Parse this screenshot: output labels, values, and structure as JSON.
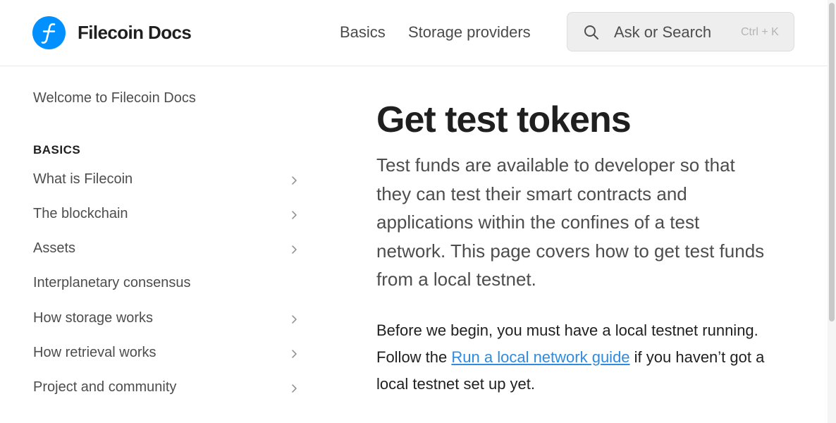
{
  "brand": {
    "name": "Filecoin Docs",
    "logo_icon": "filecoin-logo-icon",
    "logo_color": "#0090ff"
  },
  "topnav": {
    "items": [
      {
        "label": "Basics"
      },
      {
        "label": "Storage providers"
      }
    ]
  },
  "search": {
    "placeholder": "Ask or Search",
    "shortcut": "Ctrl + K",
    "icon": "search-icon"
  },
  "sidebar": {
    "welcome": "Welcome to Filecoin Docs",
    "section_title": "BASICS",
    "items": [
      {
        "label": "What is Filecoin",
        "has_children": true
      },
      {
        "label": "The blockchain",
        "has_children": true
      },
      {
        "label": "Assets",
        "has_children": true
      },
      {
        "label": "Interplanetary consensus",
        "has_children": false
      },
      {
        "label": "How storage works",
        "has_children": true
      },
      {
        "label": "How retrieval works",
        "has_children": true
      },
      {
        "label": "Project and community",
        "has_children": true
      }
    ]
  },
  "main": {
    "title": "Get test tokens",
    "lead": "Test funds are available to developer so that they can test their smart contracts and applications within the confines of a test network. This page covers how to get test funds from a local testnet.",
    "para1_before": "Before we begin, you must have a local testnet running. Follow the ",
    "para1_link": "Run a local network guide",
    "para1_after": " if you haven’t got a local testnet set up yet."
  },
  "colors": {
    "accent": "#0090ff",
    "link": "#2e8bdf",
    "text": "#1f1f1f",
    "muted": "#4d4d4d"
  }
}
